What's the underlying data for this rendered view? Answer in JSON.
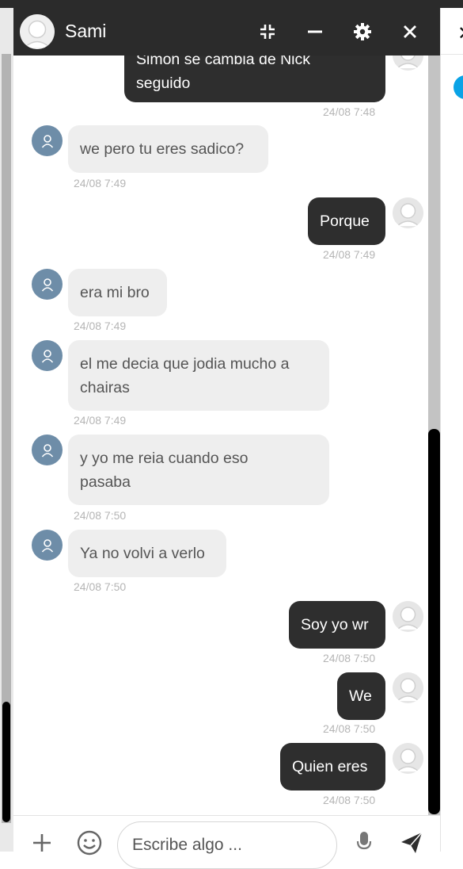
{
  "header": {
    "contact_name": "Sami",
    "icons": [
      "avatar",
      "compress-icon",
      "minimize-icon",
      "gear-icon",
      "close-icon"
    ]
  },
  "messages": [
    {
      "dir": "out",
      "text": [
        "Simon se cambia de Nick",
        "seguido"
      ],
      "time": "24/08 7:48"
    },
    {
      "dir": "in",
      "text": [
        "we pero tu eres sadico?"
      ],
      "time": "24/08 7:49"
    },
    {
      "dir": "out",
      "text": [
        "Porque"
      ],
      "time": "24/08 7:49"
    },
    {
      "dir": "in",
      "text": [
        "era mi bro"
      ],
      "time": "24/08 7:49"
    },
    {
      "dir": "in",
      "text": [
        "el me decia que jodia mucho a",
        "chairas"
      ],
      "time": "24/08 7:49"
    },
    {
      "dir": "in",
      "text": [
        "y yo me reia cuando eso",
        "pasaba"
      ],
      "time": "24/08 7:50"
    },
    {
      "dir": "in",
      "text": [
        "Ya no volvi a verlo"
      ],
      "time": "24/08 7:50"
    },
    {
      "dir": "out",
      "text": [
        "Soy yo wr"
      ],
      "time": "24/08 7:50"
    },
    {
      "dir": "out",
      "text": [
        "We"
      ],
      "time": "24/08 7:50"
    },
    {
      "dir": "out",
      "text": [
        "Quien eres"
      ],
      "time": "24/08 7:50"
    }
  ],
  "composer": {
    "placeholder": "Escribe algo ...",
    "icons": [
      "plus-icon",
      "emoji-icon",
      "microphone-icon",
      "send-icon"
    ]
  },
  "colors": {
    "header_bg": "#2b2b2b",
    "outgoing_bubble": "#2e2e2e",
    "incoming_bubble": "#eeeeee",
    "incoming_avatar": "#6e8da8",
    "timestamp": "#b5b5b5"
  }
}
